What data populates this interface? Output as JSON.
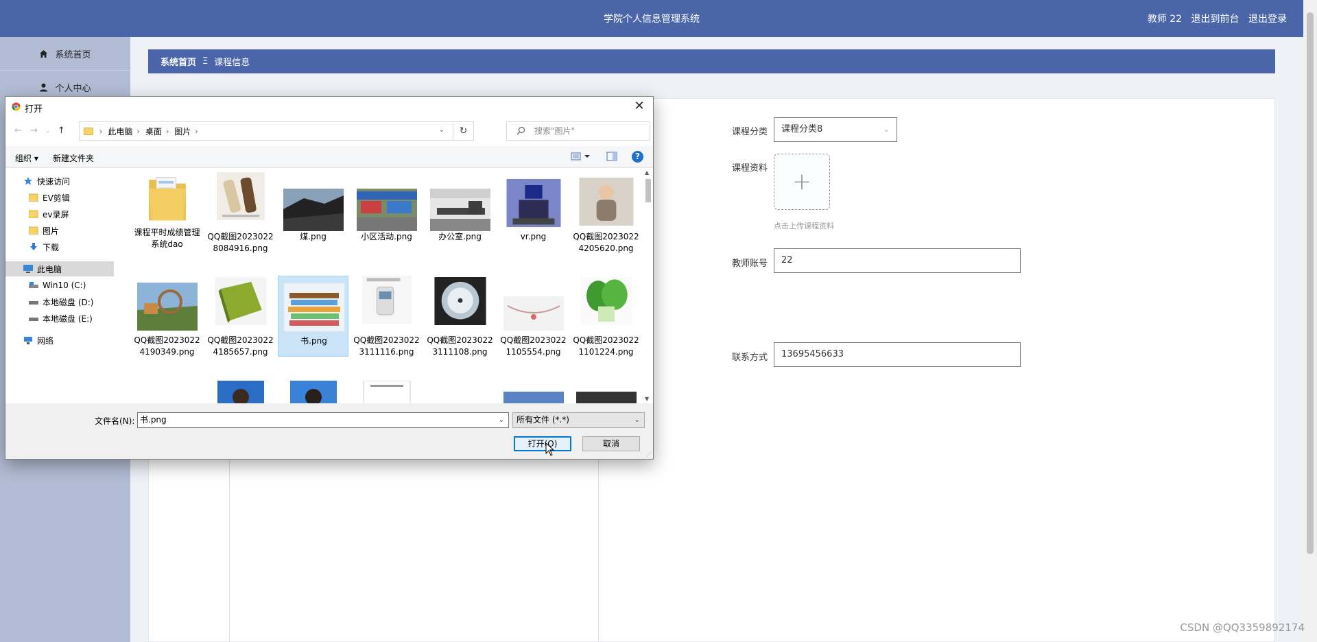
{
  "header": {
    "title": "学院个人信息管理系统",
    "user": "教师 22",
    "to_front": "退出到前台",
    "logout": "退出登录"
  },
  "sidebar": {
    "items": [
      {
        "label": "系统首页",
        "icon": "home-icon"
      },
      {
        "label": "个人中心",
        "icon": "user-icon"
      }
    ]
  },
  "breadcrumb": {
    "home": "系统首页",
    "separator": "Ξ",
    "current": "课程信息"
  },
  "form": {
    "category": {
      "label": "课程分类",
      "value": "课程分类8"
    },
    "material": {
      "label": "课程资料",
      "tip": "点击上传课程资料"
    },
    "teacher_account": {
      "label": "教师账号",
      "value": "22"
    },
    "contact": {
      "label": "联系方式",
      "value": "13695456633"
    }
  },
  "watermark": "CSDN @QQ3359892174",
  "dialog": {
    "title": "打开",
    "path": [
      "此电脑",
      "桌面",
      "图片"
    ],
    "search_placeholder": "搜索\"图片\"",
    "organize": "组织 ▾",
    "new_folder": "新建文件夹",
    "nav": [
      {
        "label": "快速访问",
        "icon": "star-icon"
      },
      {
        "label": "EV剪辑",
        "icon": "folder-icon"
      },
      {
        "label": "ev录屏",
        "icon": "folder-icon"
      },
      {
        "label": "图片",
        "icon": "folder-icon"
      },
      {
        "label": "下载",
        "icon": "download-icon"
      },
      {
        "label": "此电脑",
        "icon": "computer-icon"
      },
      {
        "label": "Win10 (C:)",
        "icon": "drive-icon"
      },
      {
        "label": "本地磁盘 (D:)",
        "icon": "drive-icon"
      },
      {
        "label": "本地磁盘 (E:)",
        "icon": "drive-icon"
      },
      {
        "label": "网络",
        "icon": "network-icon"
      }
    ],
    "files": [
      {
        "name": "课程平时成绩管理系统dao",
        "kind": "folder"
      },
      {
        "name": "QQ截图20230228084916.png",
        "kind": "bottles"
      },
      {
        "name": "煤.png",
        "kind": "coal"
      },
      {
        "name": "小区活动.png",
        "kind": "market"
      },
      {
        "name": "办公室.png",
        "kind": "office"
      },
      {
        "name": "vr.png",
        "kind": "vr"
      },
      {
        "name": "QQ截图20230224205620.png",
        "kind": "doll"
      },
      {
        "name": "QQ截图20230224190349.png",
        "kind": "park"
      },
      {
        "name": "QQ截图20230224185657.png",
        "kind": "book-green"
      },
      {
        "name": "书.png",
        "kind": "books"
      },
      {
        "name": "QQ截图20230223111116.png",
        "kind": "device"
      },
      {
        "name": "QQ截图20230223111108.png",
        "kind": "dial"
      },
      {
        "name": "QQ截图20230221105554.png",
        "kind": "jewelry"
      },
      {
        "name": "QQ截图20230221101224.png",
        "kind": "vegetable"
      }
    ],
    "filename_label": "文件名(N):",
    "filename_value": "书.png",
    "filetype": "所有文件 (*.*)",
    "open": "打开(O)",
    "cancel": "取消"
  }
}
